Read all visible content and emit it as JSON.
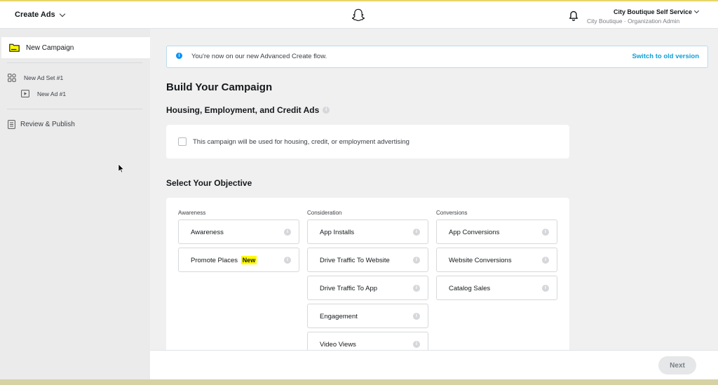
{
  "header": {
    "app_menu_label": "Create Ads",
    "logo_icon": "snapchat-ghost-icon",
    "notification_icon": "bell-icon",
    "account_name": "City Boutique Self Service",
    "account_org": "City Boutique · Organization Admin"
  },
  "sidebar": {
    "items": [
      {
        "label": "New Campaign",
        "icon": "campaign-folder-icon"
      },
      {
        "label": "New Ad Set #1",
        "icon": "ad-set-grid-icon"
      },
      {
        "label": "New Ad #1",
        "icon": "ad-play-icon"
      },
      {
        "label": "Review & Publish",
        "icon": "review-list-icon"
      }
    ]
  },
  "banner": {
    "text": "You're now on our new Advanced Create flow.",
    "link": "Switch to old version"
  },
  "main": {
    "title": "Build Your Campaign",
    "housing_heading": "Housing, Employment, and Credit Ads",
    "housing_checkbox_label": "This campaign will be used for housing, credit, or employment advertising",
    "objective_heading": "Select Your Objective",
    "columns": [
      {
        "heading": "Awareness",
        "items": [
          "Awareness",
          "Promote Places"
        ]
      },
      {
        "heading": "Consideration",
        "items": [
          "App Installs",
          "Drive Traffic To Website",
          "Drive Traffic To App",
          "Engagement",
          "Video Views"
        ]
      },
      {
        "heading": "Conversions",
        "items": [
          "App Conversions",
          "Website Conversions",
          "Catalog Sales"
        ]
      }
    ],
    "new_badge": "New"
  },
  "footer": {
    "next_label": "Next"
  },
  "colors": {
    "accent_blue": "#0fa0d8",
    "badge_yellow": "#fffc00",
    "top_border": "#e6d66a"
  }
}
